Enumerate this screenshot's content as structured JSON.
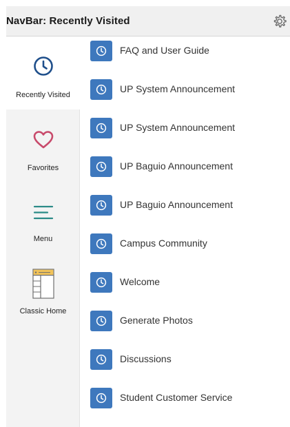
{
  "header": {
    "title": "NavBar: Recently Visited",
    "settings_icon": "gear-icon"
  },
  "sidebar": {
    "items": [
      {
        "label": "Recently Visited",
        "icon": "clock-icon",
        "active": true
      },
      {
        "label": "Favorites",
        "icon": "heart-icon",
        "active": false
      },
      {
        "label": "Menu",
        "icon": "menu-icon",
        "active": false
      },
      {
        "label": "Classic Home",
        "icon": "classic-home-icon",
        "active": false
      }
    ]
  },
  "recent": {
    "icon": "clock-icon",
    "items": [
      {
        "label": "FAQ and User Guide"
      },
      {
        "label": "UP System Announcement"
      },
      {
        "label": "UP System Announcement"
      },
      {
        "label": "UP Baguio Announcement"
      },
      {
        "label": "UP Baguio Announcement"
      },
      {
        "label": "Campus Community"
      },
      {
        "label": "Welcome"
      },
      {
        "label": "Generate Photos"
      },
      {
        "label": "Discussions"
      },
      {
        "label": "Student Customer Service"
      }
    ]
  },
  "colors": {
    "accent_blue": "#3e78bd",
    "clock_navy": "#1f4f8b",
    "heart_pink": "#c84a6b",
    "menu_teal": "#2a8a86",
    "header_bg": "#f0f0f0",
    "sidebar_bg": "#f3f3f3"
  }
}
